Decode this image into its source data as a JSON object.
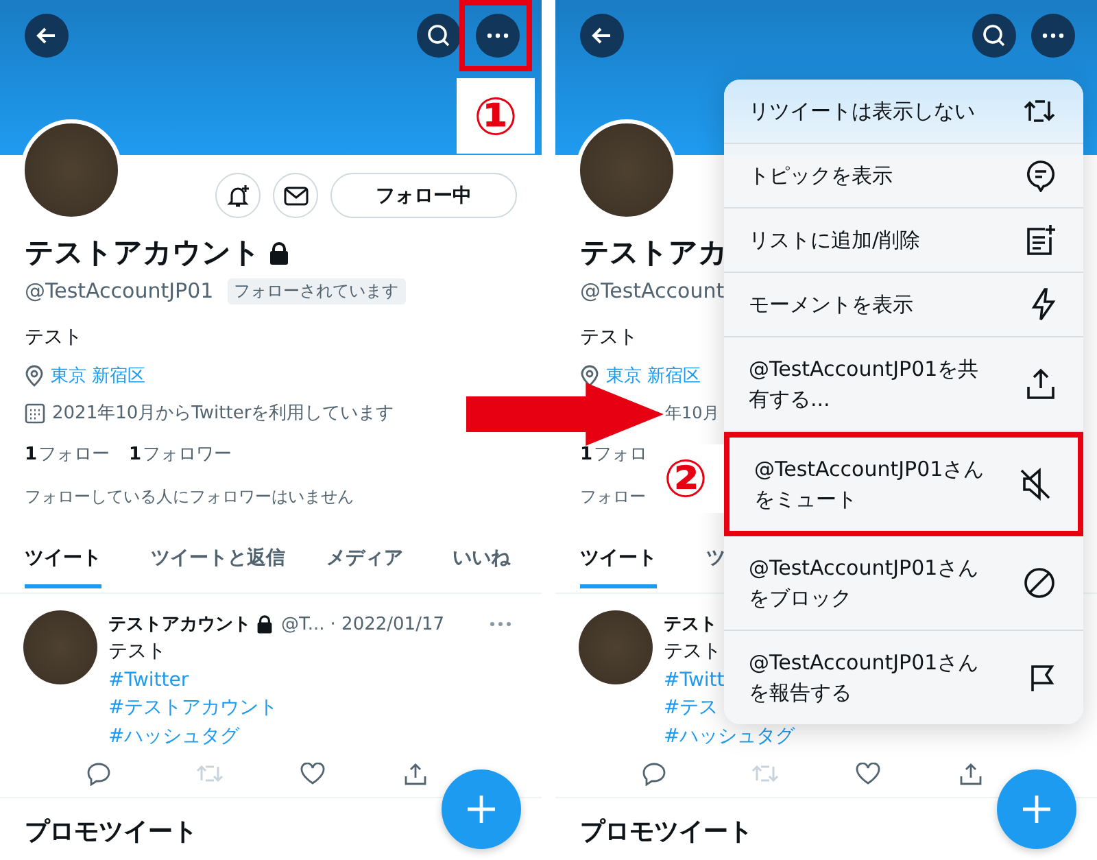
{
  "panels": [
    {
      "header": {
        "more_highlighted": true,
        "step_label": "①"
      },
      "profile": {
        "name": "テストアカウント",
        "locked": true,
        "handle": "@TestAccountJP01",
        "follows_you": "フォローされています",
        "bio": "テスト",
        "location": "東京 新宿区",
        "joined_icon": true,
        "joined": "2021年10月からTwitterを利用しています",
        "following_count": "1",
        "following_label": "フォロー",
        "followers_count": "1",
        "followers_label": "フォロワー",
        "note": "フォローしている人にフォロワーはいません",
        "follow_button": "フォロー中"
      },
      "tabs": [
        {
          "label": "ツイート",
          "selected": true
        },
        {
          "label": "ツイートと返信",
          "selected": false
        },
        {
          "label": "メディア",
          "selected": false
        },
        {
          "label": "いいね",
          "selected": false
        }
      ],
      "tweet": {
        "author": "テストアカウント",
        "locked": true,
        "handle": "@T...",
        "date": "· 2022/01/17",
        "lines": [
          {
            "kind": "text",
            "text": "テスト"
          },
          {
            "kind": "hashtag",
            "text": "#Twitter"
          },
          {
            "kind": "hashtag",
            "text": "#テストアカウント"
          },
          {
            "kind": "hashtag",
            "text": "#ハッシュタグ"
          }
        ]
      },
      "section_title": "プロモツイート"
    },
    {
      "profile": {
        "name": "テストアカ",
        "handle": "@TestAccount",
        "bio": "テスト",
        "location": "東京 新宿区",
        "joined": "年10月",
        "following_count": "1",
        "following_label": "フォロ",
        "note": "フォロー"
      },
      "tabs": [
        {
          "label": "ツイート",
          "selected": true
        },
        {
          "label": "ツ",
          "selected": false
        }
      ],
      "tweet": {
        "author": "テスト",
        "lines": [
          {
            "kind": "text",
            "text": "テスト"
          },
          {
            "kind": "hashtag",
            "text": "#Twitt"
          },
          {
            "kind": "hashtag",
            "text": "#テス"
          },
          {
            "kind": "hashtag",
            "text": "#ハッシュタグ"
          }
        ]
      },
      "section_title": "プロモツイート",
      "menu": {
        "step_label": "②",
        "items": [
          {
            "label": "リツイートは表示しない",
            "kind": "retweet",
            "highlighted": false
          },
          {
            "label": "トピックを表示",
            "kind": "topic",
            "highlighted": false
          },
          {
            "label": "リストに追加/削除",
            "kind": "list",
            "highlighted": false
          },
          {
            "label": "モーメントを表示",
            "kind": "moment",
            "highlighted": false
          },
          {
            "label": "@TestAccountJP01を共有する...",
            "kind": "share",
            "highlighted": false
          },
          {
            "label": "@TestAccountJP01さんをミュート",
            "kind": "mute",
            "highlighted": true
          },
          {
            "label": "@TestAccountJP01さんをブロック",
            "kind": "block",
            "highlighted": false
          },
          {
            "label": "@TestAccountJP01さんを報告する",
            "kind": "report",
            "highlighted": false
          }
        ]
      }
    }
  ]
}
